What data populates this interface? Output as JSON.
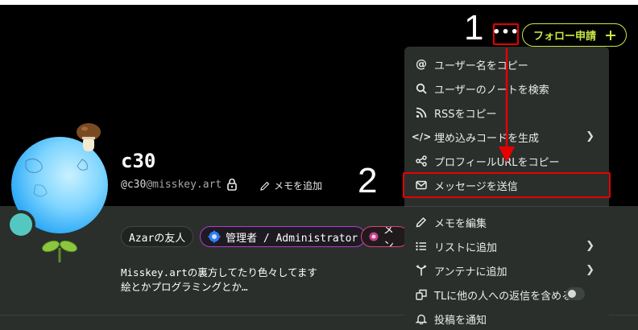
{
  "annotations": {
    "step1": "1",
    "step2": "2"
  },
  "profile": {
    "username": "c30",
    "acct_user": "@c30",
    "acct_host": "@misskey.art",
    "memo_add_label": "メモを追加",
    "badges": {
      "friend": "Azarの友人",
      "admin": "管理者 / Administrator",
      "third": "メン"
    },
    "bio_line1": "Misskey.artの裏方してたり色々してます",
    "bio_line2": "絵とかプログラミングとか…"
  },
  "header": {
    "more_label": "•••",
    "follow_label": "フォロー申請",
    "follow_icon": "plus-icon"
  },
  "menu": {
    "items": [
      {
        "label": "ユーザー名をコピー",
        "icon": "at-icon"
      },
      {
        "label": "ユーザーのノートを検索",
        "icon": "search-icon"
      },
      {
        "label": "RSSをコピー",
        "icon": "rss-icon"
      },
      {
        "label": "埋め込みコードを生成",
        "icon": "code-icon",
        "submenu": true
      },
      {
        "label": "プロフィールURLをコピー",
        "icon": "share-icon"
      },
      {
        "label": "メッセージを送信",
        "icon": "mail-icon"
      },
      {
        "label": "メモを編集",
        "icon": "pencil-icon"
      },
      {
        "label": "リストに追加",
        "icon": "list-icon",
        "submenu": true
      },
      {
        "label": "アンテナに追加",
        "icon": "antenna-icon",
        "submenu": true
      },
      {
        "label": "TLに他の人への返信を含める",
        "icon": "reply-icon",
        "toggle": false
      },
      {
        "label": "投稿を通知",
        "icon": "bell-icon"
      }
    ]
  },
  "colors": {
    "accent_follow": "#c7e845",
    "highlight_red": "#e60000",
    "admin_border": "#b03dcf"
  }
}
